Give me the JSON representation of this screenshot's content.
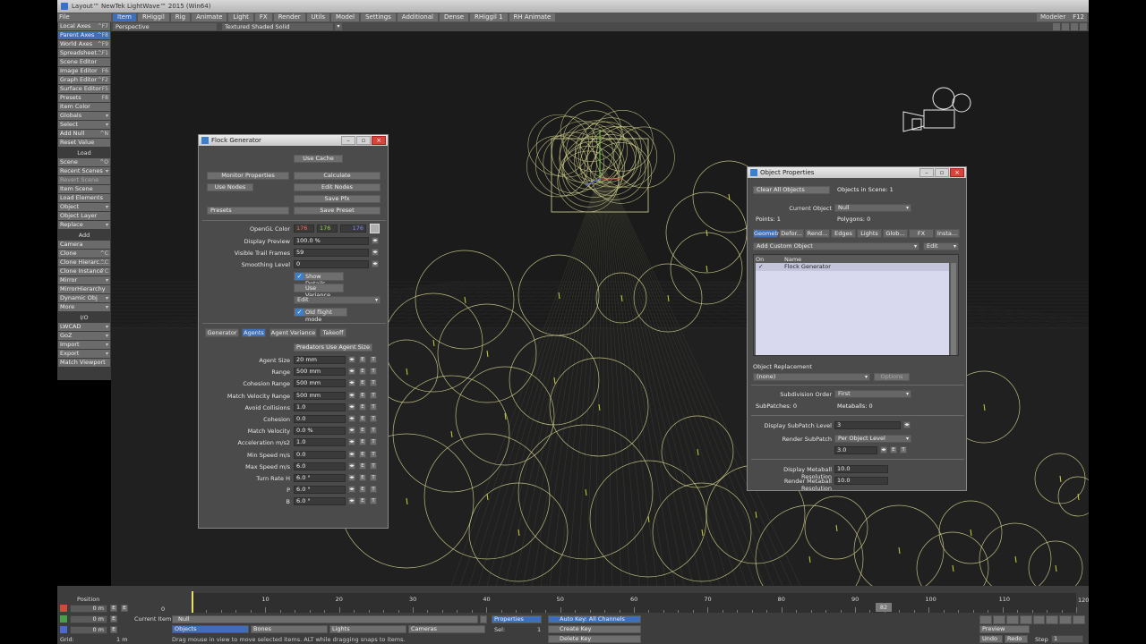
{
  "window": {
    "title": "Layout™ NewTek LightWave™ 2015 (Win64)"
  },
  "menubar": {
    "file": "File",
    "tabs": [
      "Item",
      "RHiggil",
      "Rig",
      "Animate",
      "Light",
      "FX",
      "Render",
      "Utils",
      "Model",
      "Settings",
      "Additional",
      "Dense",
      "RHiggil 1",
      "RH Animate"
    ],
    "modeler": "Modeler",
    "modeler_key": "F12"
  },
  "sidebar": {
    "top": [
      {
        "label": "Local Axes",
        "key": "^F7"
      },
      {
        "label": "Parent Axes",
        "key": "^F8"
      },
      {
        "label": "World Axes",
        "key": "^F9"
      },
      {
        "label": "Spreadsheet...",
        "key": "^F1"
      },
      {
        "label": "Scene Editor",
        "key": ""
      },
      {
        "label": "Image Editor",
        "key": "F6"
      },
      {
        "label": "Graph Editor",
        "key": "^F2"
      },
      {
        "label": "Surface Editor",
        "key": "F5"
      },
      {
        "label": "Presets",
        "key": "F8"
      },
      {
        "label": "Item Color",
        "key": ""
      },
      {
        "label": "Globals",
        "key": "▾"
      },
      {
        "label": "Select",
        "key": "▾"
      },
      {
        "label": "Add Null",
        "key": "^N"
      },
      {
        "label": "Reset Value",
        "key": ""
      }
    ],
    "load_head": "Load",
    "load": [
      {
        "label": "Scene",
        "key": "^O"
      },
      {
        "label": "Recent Scenes",
        "key": "▾"
      },
      {
        "label": "Revert Scene",
        "key": ""
      },
      {
        "label": "Item Scene",
        "key": ""
      },
      {
        "label": "Load Elements",
        "key": ""
      },
      {
        "label": "Object",
        "key": "▾"
      },
      {
        "label": "Object Layer",
        "key": ""
      },
      {
        "label": "Replace",
        "key": "▾"
      }
    ],
    "add_head": "Add",
    "add": [
      {
        "label": "Camera",
        "key": ""
      },
      {
        "label": "Clone",
        "key": "^C"
      },
      {
        "label": "Clone Hierarc...",
        "key": "^C"
      },
      {
        "label": "Clone Instance",
        "key": "^C"
      },
      {
        "label": "Mirror",
        "key": "▾"
      },
      {
        "label": "MirrorHierarchy",
        "key": ""
      },
      {
        "label": "Dynamic Obj",
        "key": "▾"
      },
      {
        "label": "More",
        "key": "▾"
      }
    ],
    "io_head": "I/O",
    "io": [
      {
        "label": "LWCAD",
        "key": "▾"
      },
      {
        "label": "GoZ",
        "key": "▾"
      },
      {
        "label": "Import",
        "key": "▾"
      },
      {
        "label": "Export",
        "key": "▾"
      },
      {
        "label": "Match Viewport",
        "key": ""
      }
    ]
  },
  "viewbar": {
    "view": "Perspective",
    "shading": "Textured Shaded Solid"
  },
  "flock": {
    "title": "Flock Generator",
    "use_cache": "Use Cache",
    "monitor_properties": "Monitor Properties",
    "calculate": "Calculate",
    "use_nodes": "Use Nodes",
    "edit_nodes": "Edit Nodes",
    "save_pfx": "Save Pfx",
    "presets": "Presets",
    "save_preset": "Save Preset",
    "opengl_color_label": "OpenGL Color",
    "color_r": "176",
    "color_g": "176",
    "color_b": "176",
    "display_preview_label": "Display Preview",
    "display_preview": "100.0 %",
    "trail_frames_label": "Visible Trail Frames",
    "trail_frames": "59",
    "smoothing_label": "Smoothing Level",
    "smoothing": "0",
    "show_details": "Show Details",
    "use_variance": "Use Variance",
    "edit": "Edit",
    "old_flight": "Old flight mode",
    "tabs": [
      "Generator",
      "Agents",
      "Agent Variance",
      "Takeoff"
    ],
    "predators": "Predators Use Agent Size",
    "params": [
      {
        "label": "Agent Size",
        "value": "20 mm"
      },
      {
        "label": "Range",
        "value": "500 mm"
      },
      {
        "label": "Cohesion Range",
        "value": "500 mm"
      },
      {
        "label": "Match Velocity Range",
        "value": "500 mm"
      },
      {
        "label": "Avoid Collisions",
        "value": "1.0"
      },
      {
        "label": "Cohesion",
        "value": "0.0"
      },
      {
        "label": "Match Velocity",
        "value": "0.0 %"
      },
      {
        "label": "Acceleration m/s2",
        "value": "1.0"
      },
      {
        "label": "Min Speed m/s",
        "value": "0.0"
      },
      {
        "label": "Max Speed m/s",
        "value": "6.0"
      },
      {
        "label": "Turn Rate H",
        "value": "6.0 °"
      },
      {
        "label": "P",
        "value": "6.0 °"
      },
      {
        "label": "B",
        "value": "6.0 °"
      }
    ]
  },
  "objprops": {
    "title": "Object Properties",
    "clear_all": "Clear All Objects",
    "objects_in_scene": "Objects in Scene: 1",
    "current_object_label": "Current Object",
    "current_object": "Null",
    "points": "Points: 1",
    "polygons": "Polygons: 0",
    "tabs": [
      "Geometry",
      "Defor...",
      "Rend...",
      "Edges",
      "Lights",
      "Glob...",
      "FX",
      "Insta..."
    ],
    "add_custom": "Add Custom Object",
    "edit": "Edit",
    "col_on": "On",
    "col_name": "Name",
    "list_row_check": "✓",
    "list_row_name": "Flock Generator",
    "replacement_head": "Object Replacement",
    "replacement_value": "(none)",
    "options": "Options",
    "subdiv_order_label": "Subdivision Order",
    "subdiv_order": "First",
    "subpatches": "SubPatches: 0",
    "metaballs": "Metaballs: 0",
    "display_subpatch_label": "Display SubPatch Level",
    "display_subpatch": "3",
    "render_subpatch_label": "Render SubPatch",
    "render_subpatch": "Per Object Level",
    "render_subpatch_val": "3.0",
    "display_metaball_label": "Display Metaball Resolution",
    "display_metaball": "10.0",
    "render_metaball_label": "Render Metaball Resolution",
    "render_metaball": "10.0"
  },
  "timeline": {
    "position_label": "Position",
    "x": "0 m",
    "y": "0 m",
    "z": "0 m",
    "grid_label": "Grid:",
    "grid_value": "1 m",
    "frame_start": "0",
    "ticks": [
      "10",
      "20",
      "30",
      "40",
      "50",
      "60",
      "70",
      "80",
      "90",
      "100",
      "110"
    ],
    "frame_end": "120",
    "current_item_label": "Current Item",
    "current_item": "Null",
    "objects": "Objects",
    "bones": "Bones",
    "lights": "Lights",
    "cameras": "Cameras",
    "properties": "Properties",
    "sel_label": "Sel:",
    "sel_value": "1",
    "auto_key": "Auto Key: All Channels",
    "create_key": "Create Key",
    "delete_key": "Delete Key",
    "status": "Drag mouse in view to move selected items. ALT while dragging snaps to items.",
    "preview": "Preview",
    "undo": "Undo",
    "redo": "Redo",
    "step_label": "Step",
    "step_value": "1",
    "marker_frame": "82"
  },
  "colors": {
    "accent": "#3f6fb8",
    "wire": "#d8d890",
    "red_channel": "#ff6a5a",
    "green_channel": "#8fd24a",
    "blue_channel": "#7d8aff"
  }
}
